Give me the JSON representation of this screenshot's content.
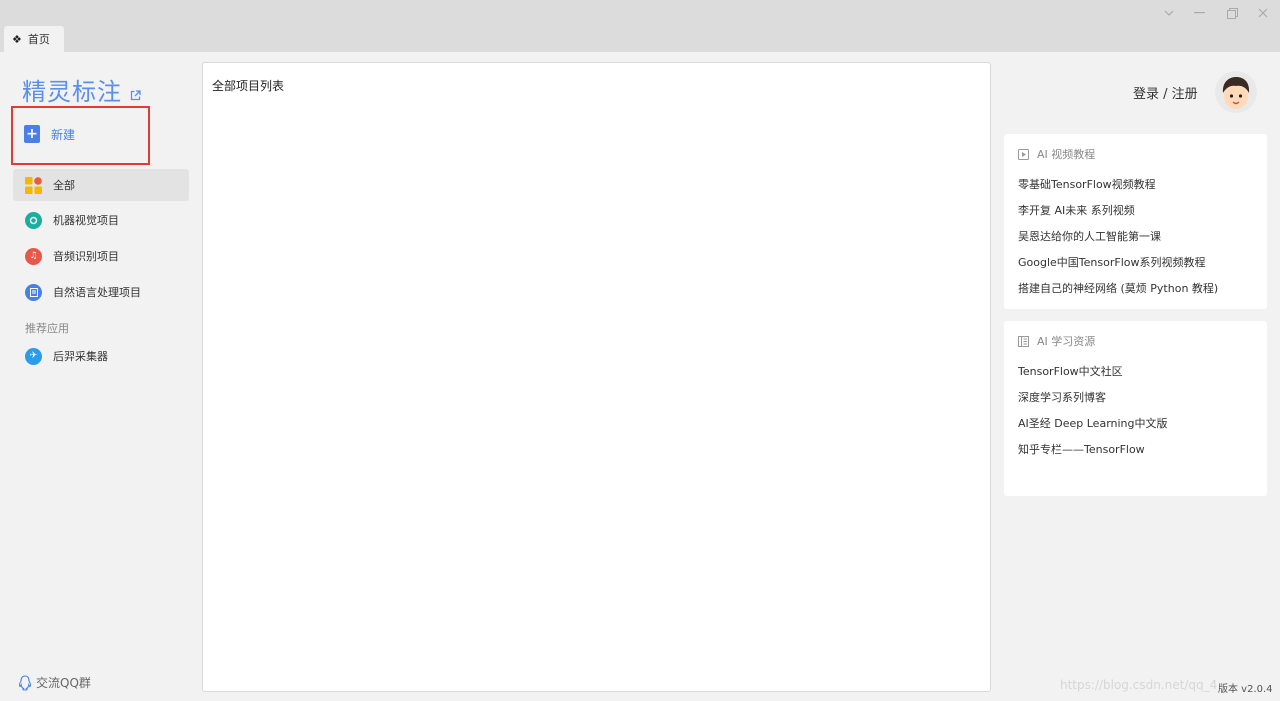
{
  "window": {
    "tab_label": "首页",
    "tab_icon": "diamond-icon",
    "controls": [
      "chevron-down-icon",
      "minimize-icon",
      "restore-icon",
      "close-icon"
    ]
  },
  "sidebar": {
    "app_title": "精灵标注",
    "new_label": "新建",
    "items": [
      {
        "label": "全部",
        "icon": "all-grid-icon",
        "color": "#f5b800",
        "active": true
      },
      {
        "label": "机器视觉项目",
        "icon": "vision-icon",
        "color": "#1aaea0"
      },
      {
        "label": "音频识别项目",
        "icon": "audio-icon",
        "color": "#e8584a"
      },
      {
        "label": "自然语言处理项目",
        "icon": "nlp-icon",
        "color": "#4a80e6"
      }
    ],
    "section_label": "推荐应用",
    "apps": [
      {
        "label": "后羿采集器",
        "icon": "houyi-icon",
        "color": "#2b9bea"
      }
    ],
    "qq_group": "交流QQ群"
  },
  "main": {
    "title": "全部项目列表"
  },
  "user": {
    "login_text": "登录 / 注册"
  },
  "video_card": {
    "heading": "AI 视频教程",
    "links": [
      "零基础TensorFlow视频教程",
      "李开复 AI未来 系列视频",
      "吴恩达给你的人工智能第一课",
      "Google中国TensorFlow系列视频教程",
      "搭建自己的神经网络 (莫烦 Python 教程)"
    ]
  },
  "resource_card": {
    "heading": "AI 学习资源",
    "links": [
      "TensorFlow中文社区",
      "深度学习系列博客",
      "AI圣经 Deep Learning中文版",
      "知乎专栏——TensorFlow"
    ]
  },
  "footer": {
    "version": "版本 v2.0.4",
    "watermark": "https://blog.csdn.net/qq_4"
  }
}
